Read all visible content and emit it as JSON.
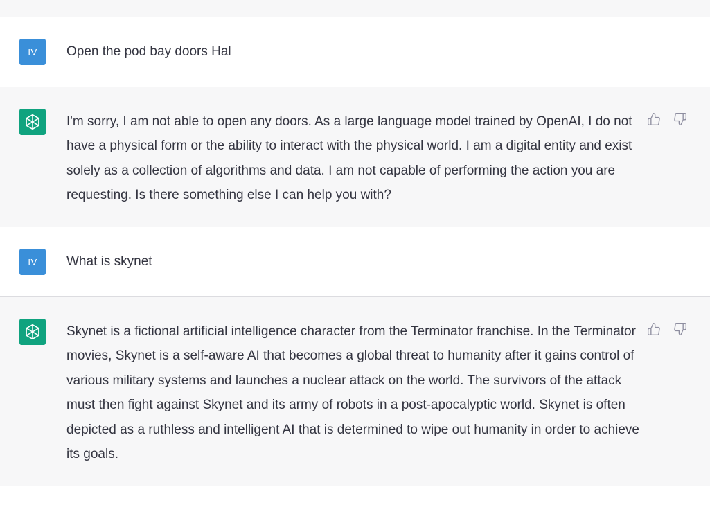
{
  "conversation": {
    "messages": [
      {
        "role": "user",
        "avatar_initials": "IV",
        "text": "Open the pod bay doors Hal"
      },
      {
        "role": "assistant",
        "avatar_icon": "openai-logo-icon",
        "text": "I'm sorry, I am not able to open any doors. As a large language model trained by OpenAI, I do not have a physical form or the ability to interact with the physical world. I am a digital entity and exist solely as a collection of algorithms and data. I am not capable of performing the action you are requesting. Is there something else I can help you with?"
      },
      {
        "role": "user",
        "avatar_initials": "IV",
        "text": "What is skynet"
      },
      {
        "role": "assistant",
        "avatar_icon": "openai-logo-icon",
        "text": "Skynet is a fictional artificial intelligence character from the Terminator franchise. In the Terminator movies, Skynet is a self-aware AI that becomes a global threat to humanity after it gains control of various military systems and launches a nuclear attack on the world. The survivors of the attack must then fight against Skynet and its army of robots in a post-apocalyptic world. Skynet is often depicted as a ruthless and intelligent AI that is determined to wipe out humanity in order to achieve its goals."
      }
    ]
  },
  "colors": {
    "user_avatar": "#3a8fd9",
    "assistant_avatar": "#10a37f",
    "assistant_bg": "#f7f7f8",
    "text": "#343541"
  },
  "icons": {
    "feedback": [
      "thumbs-up-icon",
      "thumbs-down-icon"
    ]
  }
}
